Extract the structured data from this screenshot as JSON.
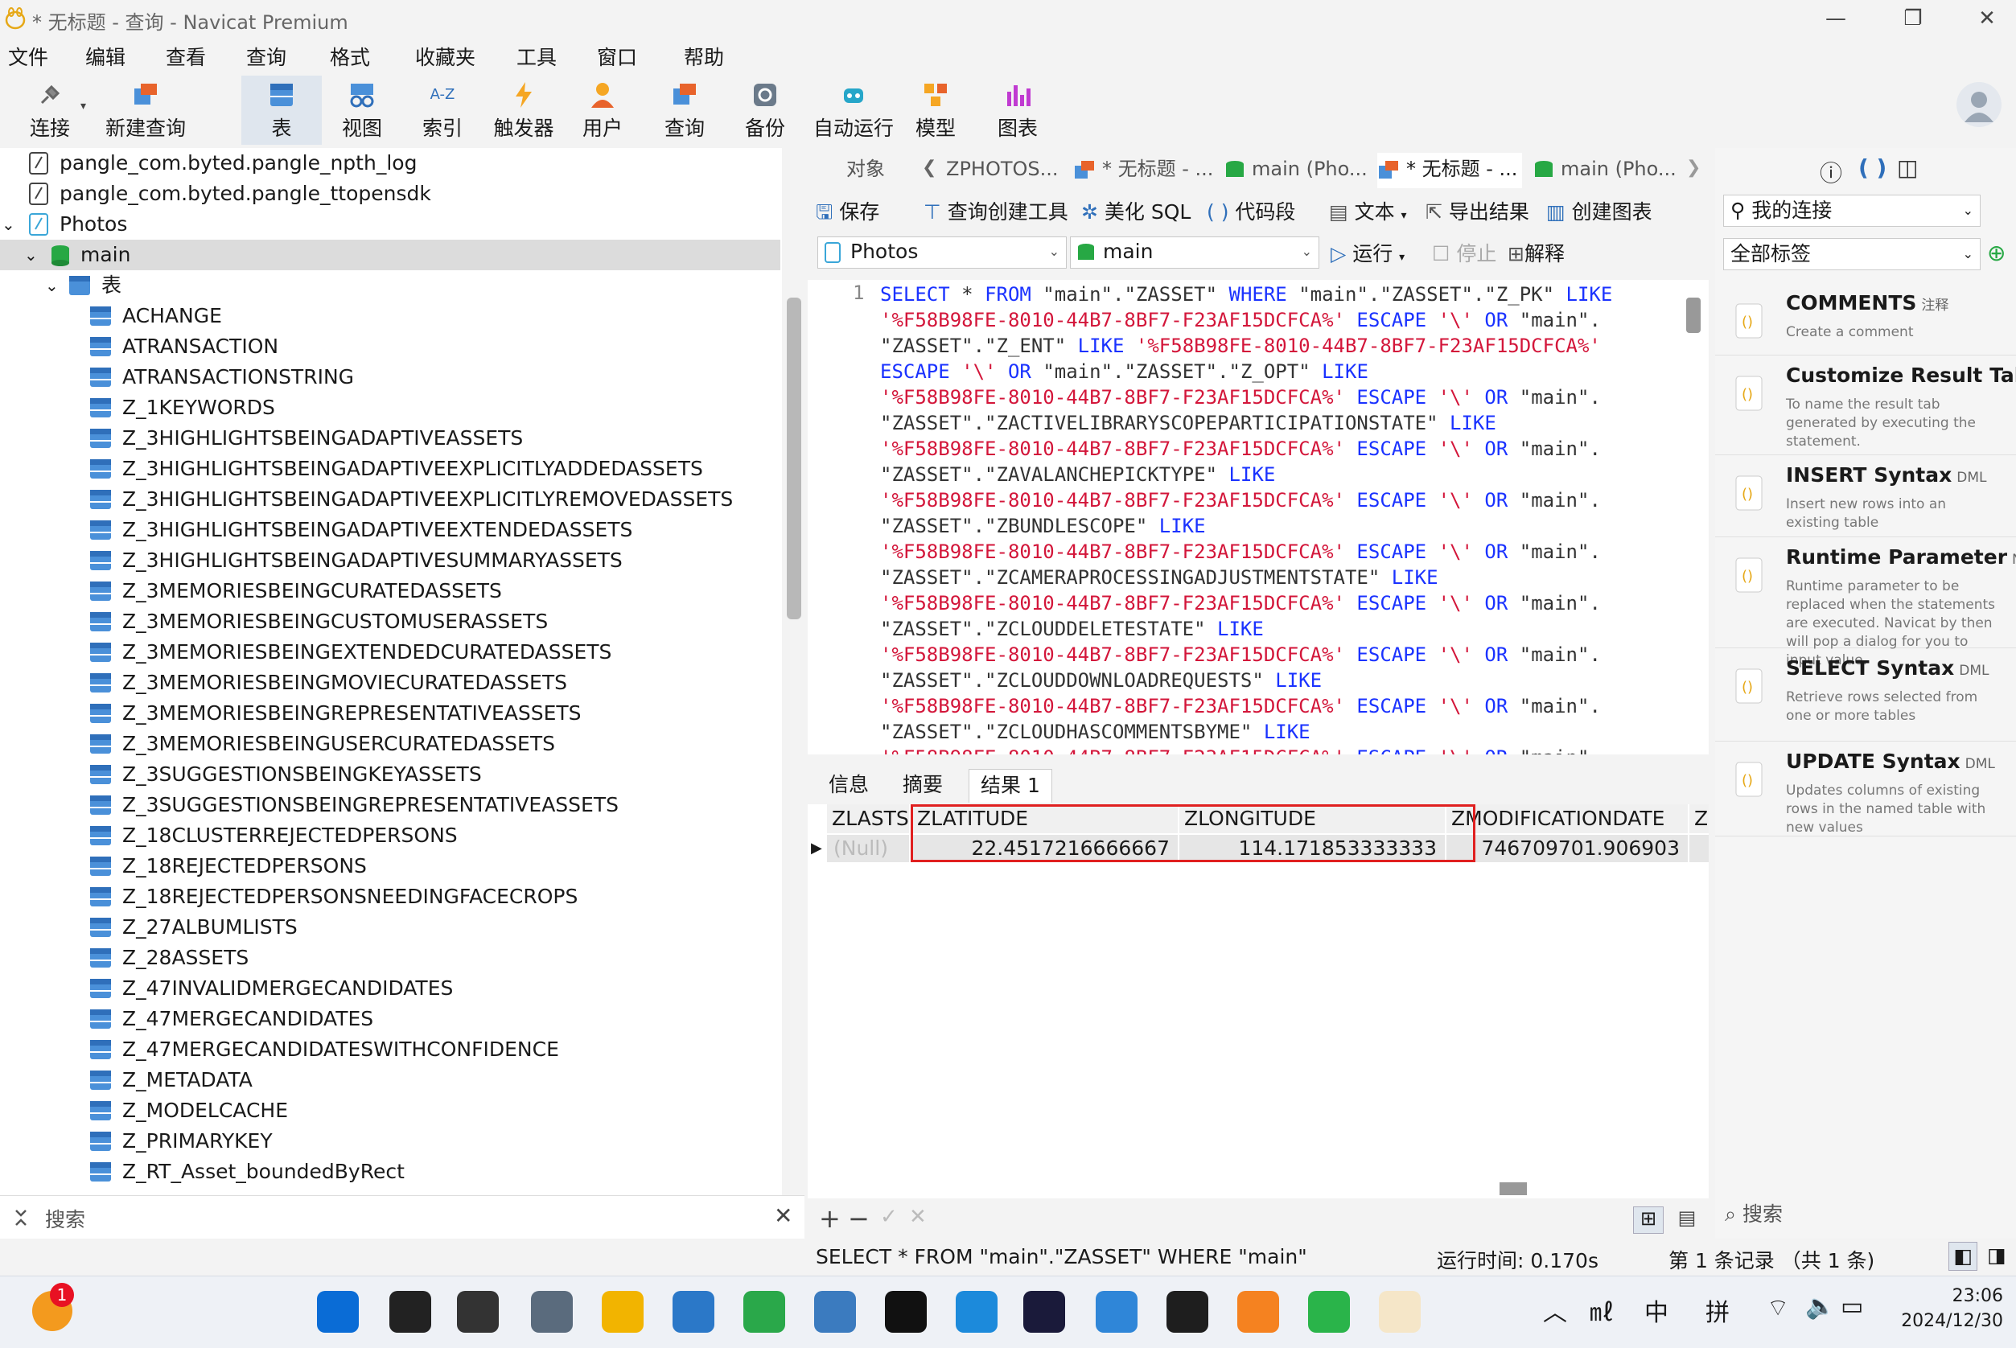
{
  "window": {
    "title": "* 无标题 - 查询 - Navicat Premium",
    "minimize": "—",
    "maximize": "❐",
    "close": "✕"
  },
  "menu": [
    "文件",
    "编辑",
    "查看",
    "查询",
    "格式",
    "收藏夹",
    "工具",
    "窗口",
    "帮助"
  ],
  "toolbar": {
    "items": [
      {
        "label": "连接",
        "icon": "plug-icon"
      },
      {
        "label": "新建查询",
        "icon": "new-query-icon"
      },
      {
        "label": "表",
        "icon": "table-icon"
      },
      {
        "label": "视图",
        "icon": "view-icon"
      },
      {
        "label": "索引",
        "icon": "index-icon"
      },
      {
        "label": "触发器",
        "icon": "trigger-icon"
      },
      {
        "label": "用户",
        "icon": "user-icon"
      },
      {
        "label": "查询",
        "icon": "query-icon"
      },
      {
        "label": "备份",
        "icon": "backup-icon"
      },
      {
        "label": "自动运行",
        "icon": "robot-icon"
      },
      {
        "label": "模型",
        "icon": "model-icon"
      },
      {
        "label": "图表",
        "icon": "chart-icon"
      }
    ],
    "active_label": "表",
    "index_glyph": "A-Z"
  },
  "navigator": {
    "files": [
      "pangle_com.byted.pangle_npth_log",
      "pangle_com.byted.pangle_ttopensdk"
    ],
    "connection": "Photos",
    "schema": "main",
    "group": "表",
    "tables": [
      "ACHANGE",
      "ATRANSACTION",
      "ATRANSACTIONSTRING",
      "Z_1KEYWORDS",
      "Z_3HIGHLIGHTSBEINGADAPTIVEASSETS",
      "Z_3HIGHLIGHTSBEINGADAPTIVEEXPLICITLYADDEDASSETS",
      "Z_3HIGHLIGHTSBEINGADAPTIVEEXPLICITLYREMOVEDASSETS",
      "Z_3HIGHLIGHTSBEINGADAPTIVEEXTENDEDASSETS",
      "Z_3HIGHLIGHTSBEINGADAPTIVESUMMARYASSETS",
      "Z_3MEMORIESBEINGCURATEDASSETS",
      "Z_3MEMORIESBEINGCUSTOMUSERASSETS",
      "Z_3MEMORIESBEINGEXTENDEDCURATEDASSETS",
      "Z_3MEMORIESBEINGMOVIECURATEDASSETS",
      "Z_3MEMORIESBEINGREPRESENTATIVEASSETS",
      "Z_3MEMORIESBEINGUSERCURATEDASSETS",
      "Z_3SUGGESTIONSBEINGKEYASSETS",
      "Z_3SUGGESTIONSBEINGREPRESENTATIVEASSETS",
      "Z_18CLUSTERREJECTEDPERSONS",
      "Z_18REJECTEDPERSONS",
      "Z_18REJECTEDPERSONSNEEDINGFACECROPS",
      "Z_27ALBUMLISTS",
      "Z_28ASSETS",
      "Z_47INVALIDMERGECANDIDATES",
      "Z_47MERGECANDIDATES",
      "Z_47MERGECANDIDATESWITHCONFIDENCE",
      "Z_METADATA",
      "Z_MODELCACHE",
      "Z_PRIMARYKEY",
      "Z_RT_Asset_boundedByRect"
    ],
    "search_placeholder": "搜索"
  },
  "tabs": {
    "objects": "对象",
    "docs": [
      "ZPHOTOS...",
      "* 无标题 - ...",
      "main (Pho...",
      "* 无标题 - ...",
      "main (Pho..."
    ]
  },
  "query_toolbar": {
    "save": "保存",
    "builder": "查询创建工具",
    "beautify": "美化 SQL",
    "snippet": "代码段",
    "text": "文本",
    "export": "导出结果",
    "chart": "创建图表",
    "run": "运行",
    "stop": "停止",
    "explain": "解释",
    "connection_select": "Photos",
    "schema_select": "main"
  },
  "editor": {
    "line_number": "1",
    "lines": [
      [
        [
          "kw",
          "SELECT"
        ],
        [
          "id",
          " * "
        ],
        [
          "kw",
          "FROM"
        ],
        [
          "id",
          " \"main\".\"ZASSET\" "
        ],
        [
          "kw",
          "WHERE"
        ],
        [
          "id",
          " \"main\".\"ZASSET\".\"Z_PK\" "
        ],
        [
          "kw",
          "LIKE"
        ]
      ],
      [
        [
          "str",
          "'%F58B98FE-8010-44B7-8BF7-F23AF15DCFCA%'"
        ],
        [
          "id",
          " "
        ],
        [
          "kw",
          "ESCAPE"
        ],
        [
          "id",
          " "
        ],
        [
          "str",
          "'\\'"
        ],
        [
          "id",
          " "
        ],
        [
          "kw",
          "OR"
        ],
        [
          "id",
          " \"main\"."
        ]
      ],
      [
        [
          "id",
          "\"ZASSET\".\"Z_ENT\" "
        ],
        [
          "kw",
          "LIKE"
        ],
        [
          "id",
          " "
        ],
        [
          "str",
          "'%F58B98FE-8010-44B7-8BF7-F23AF15DCFCA%'"
        ]
      ],
      [
        [
          "kw",
          "ESCAPE"
        ],
        [
          "id",
          " "
        ],
        [
          "str",
          "'\\'"
        ],
        [
          "id",
          " "
        ],
        [
          "kw",
          "OR"
        ],
        [
          "id",
          " \"main\".\"ZASSET\".\"Z_OPT\" "
        ],
        [
          "kw",
          "LIKE"
        ]
      ],
      [
        [
          "str",
          "'%F58B98FE-8010-44B7-8BF7-F23AF15DCFCA%'"
        ],
        [
          "id",
          " "
        ],
        [
          "kw",
          "ESCAPE"
        ],
        [
          "id",
          " "
        ],
        [
          "str",
          "'\\'"
        ],
        [
          "id",
          " "
        ],
        [
          "kw",
          "OR"
        ],
        [
          "id",
          " \"main\"."
        ]
      ],
      [
        [
          "id",
          "\"ZASSET\".\"ZACTIVELIBRARYSCOPEPARTICIPATIONSTATE\" "
        ],
        [
          "kw",
          "LIKE"
        ]
      ],
      [
        [
          "str",
          "'%F58B98FE-8010-44B7-8BF7-F23AF15DCFCA%'"
        ],
        [
          "id",
          " "
        ],
        [
          "kw",
          "ESCAPE"
        ],
        [
          "id",
          " "
        ],
        [
          "str",
          "'\\'"
        ],
        [
          "id",
          " "
        ],
        [
          "kw",
          "OR"
        ],
        [
          "id",
          " \"main\"."
        ]
      ],
      [
        [
          "id",
          "\"ZASSET\".\"ZAVALANCHEPICKTYPE\" "
        ],
        [
          "kw",
          "LIKE"
        ]
      ],
      [
        [
          "str",
          "'%F58B98FE-8010-44B7-8BF7-F23AF15DCFCA%'"
        ],
        [
          "id",
          " "
        ],
        [
          "kw",
          "ESCAPE"
        ],
        [
          "id",
          " "
        ],
        [
          "str",
          "'\\'"
        ],
        [
          "id",
          " "
        ],
        [
          "kw",
          "OR"
        ],
        [
          "id",
          " \"main\"."
        ]
      ],
      [
        [
          "id",
          "\"ZASSET\".\"ZBUNDLESCOPE\" "
        ],
        [
          "kw",
          "LIKE"
        ]
      ],
      [
        [
          "str",
          "'%F58B98FE-8010-44B7-8BF7-F23AF15DCFCA%'"
        ],
        [
          "id",
          " "
        ],
        [
          "kw",
          "ESCAPE"
        ],
        [
          "id",
          " "
        ],
        [
          "str",
          "'\\'"
        ],
        [
          "id",
          " "
        ],
        [
          "kw",
          "OR"
        ],
        [
          "id",
          " \"main\"."
        ]
      ],
      [
        [
          "id",
          "\"ZASSET\".\"ZCAMERAPROCESSINGADJUSTMENTSTATE\" "
        ],
        [
          "kw",
          "LIKE"
        ]
      ],
      [
        [
          "str",
          "'%F58B98FE-8010-44B7-8BF7-F23AF15DCFCA%'"
        ],
        [
          "id",
          " "
        ],
        [
          "kw",
          "ESCAPE"
        ],
        [
          "id",
          " "
        ],
        [
          "str",
          "'\\'"
        ],
        [
          "id",
          " "
        ],
        [
          "kw",
          "OR"
        ],
        [
          "id",
          " \"main\"."
        ]
      ],
      [
        [
          "id",
          "\"ZASSET\".\"ZCLOUDDELETESTATE\" "
        ],
        [
          "kw",
          "LIKE"
        ]
      ],
      [
        [
          "str",
          "'%F58B98FE-8010-44B7-8BF7-F23AF15DCFCA%'"
        ],
        [
          "id",
          " "
        ],
        [
          "kw",
          "ESCAPE"
        ],
        [
          "id",
          " "
        ],
        [
          "str",
          "'\\'"
        ],
        [
          "id",
          " "
        ],
        [
          "kw",
          "OR"
        ],
        [
          "id",
          " \"main\"."
        ]
      ],
      [
        [
          "id",
          "\"ZASSET\".\"ZCLOUDDOWNLOADREQUESTS\" "
        ],
        [
          "kw",
          "LIKE"
        ]
      ],
      [
        [
          "str",
          "'%F58B98FE-8010-44B7-8BF7-F23AF15DCFCA%'"
        ],
        [
          "id",
          " "
        ],
        [
          "kw",
          "ESCAPE"
        ],
        [
          "id",
          " "
        ],
        [
          "str",
          "'\\'"
        ],
        [
          "id",
          " "
        ],
        [
          "kw",
          "OR"
        ],
        [
          "id",
          " \"main\"."
        ]
      ],
      [
        [
          "id",
          "\"ZASSET\".\"ZCLOUDHASCOMMENTSBYME\" "
        ],
        [
          "kw",
          "LIKE"
        ]
      ],
      [
        [
          "str",
          "'%F58B98FE-8010-44B7-8BF7-F23AF15DCFCA%'"
        ],
        [
          "id",
          " "
        ],
        [
          "kw",
          "ESCAPE"
        ],
        [
          "id",
          " "
        ],
        [
          "str",
          "'\\'"
        ],
        [
          "id",
          " "
        ],
        [
          "kw",
          "OR"
        ],
        [
          "id",
          " \"main\"."
        ]
      ]
    ]
  },
  "result_tabs": [
    "信息",
    "摘要",
    "结果 1"
  ],
  "grid": {
    "columns": [
      "ZLASTS",
      "ZLATITUDE",
      "ZLONGITUDE",
      "ZMODIFICATIONDATE",
      "Z"
    ],
    "row": [
      "(Null)",
      "22.4517216666667",
      "114.171853333333",
      "746709701.906903",
      ""
    ]
  },
  "grid_footer": {
    "add": "+",
    "remove": "−",
    "apply": "✓",
    "discard": "✕"
  },
  "status": {
    "sql": "SELECT * FROM \"main\".\"ZASSET\" WHERE \"main\".\"ZAS",
    "runtime": "运行时间: 0.170s",
    "record": "第 1 条记录 （共 1 条)"
  },
  "right_panel": {
    "connection_select": "我的连接",
    "tag_select": "全部标签",
    "search_placeholder": "搜索",
    "snippets": [
      {
        "title": "COMMENTS",
        "tag": "注释",
        "desc": "Create a comment"
      },
      {
        "title": "Customize Result Tab N",
        "tag": "",
        "desc": "To name the result tab generated by executing the statement."
      },
      {
        "title": "INSERT Syntax",
        "tag": "DML",
        "desc": "Insert new rows into an existing table"
      },
      {
        "title": "Runtime Parameter",
        "tag": "Navi",
        "desc": "Runtime parameter to be replaced when the statements are executed. Navicat by then will pop a dialog for you to input value."
      },
      {
        "title": "SELECT Syntax",
        "tag": "DML",
        "desc": "Retrieve rows selected from one or more tables"
      },
      {
        "title": "UPDATE Syntax",
        "tag": "DML",
        "desc": "Updates columns of existing rows in the named table with new values"
      }
    ]
  },
  "taskbar": {
    "badge": "1",
    "apps": [
      "start-icon",
      "search-icon",
      "task-view-icon",
      "settings-icon",
      "file-explorer-icon",
      "vscode-icon",
      "remote-desktop-icon",
      "python-icon",
      "typora-icon",
      "edge-icon",
      "draw-icon",
      "photos-icon",
      "terminal-icon",
      "sublime-icon",
      "wechat-icon",
      "navicat-icon"
    ],
    "tray_ime_1": "中",
    "tray_ime_2": "拼",
    "time": "23:06",
    "date": "2024/12/30"
  },
  "colors": {
    "accent": "#1a32ff",
    "string": "#d3163a",
    "highlight_border": "#e02020",
    "selected_row": "#dcdcdc"
  }
}
